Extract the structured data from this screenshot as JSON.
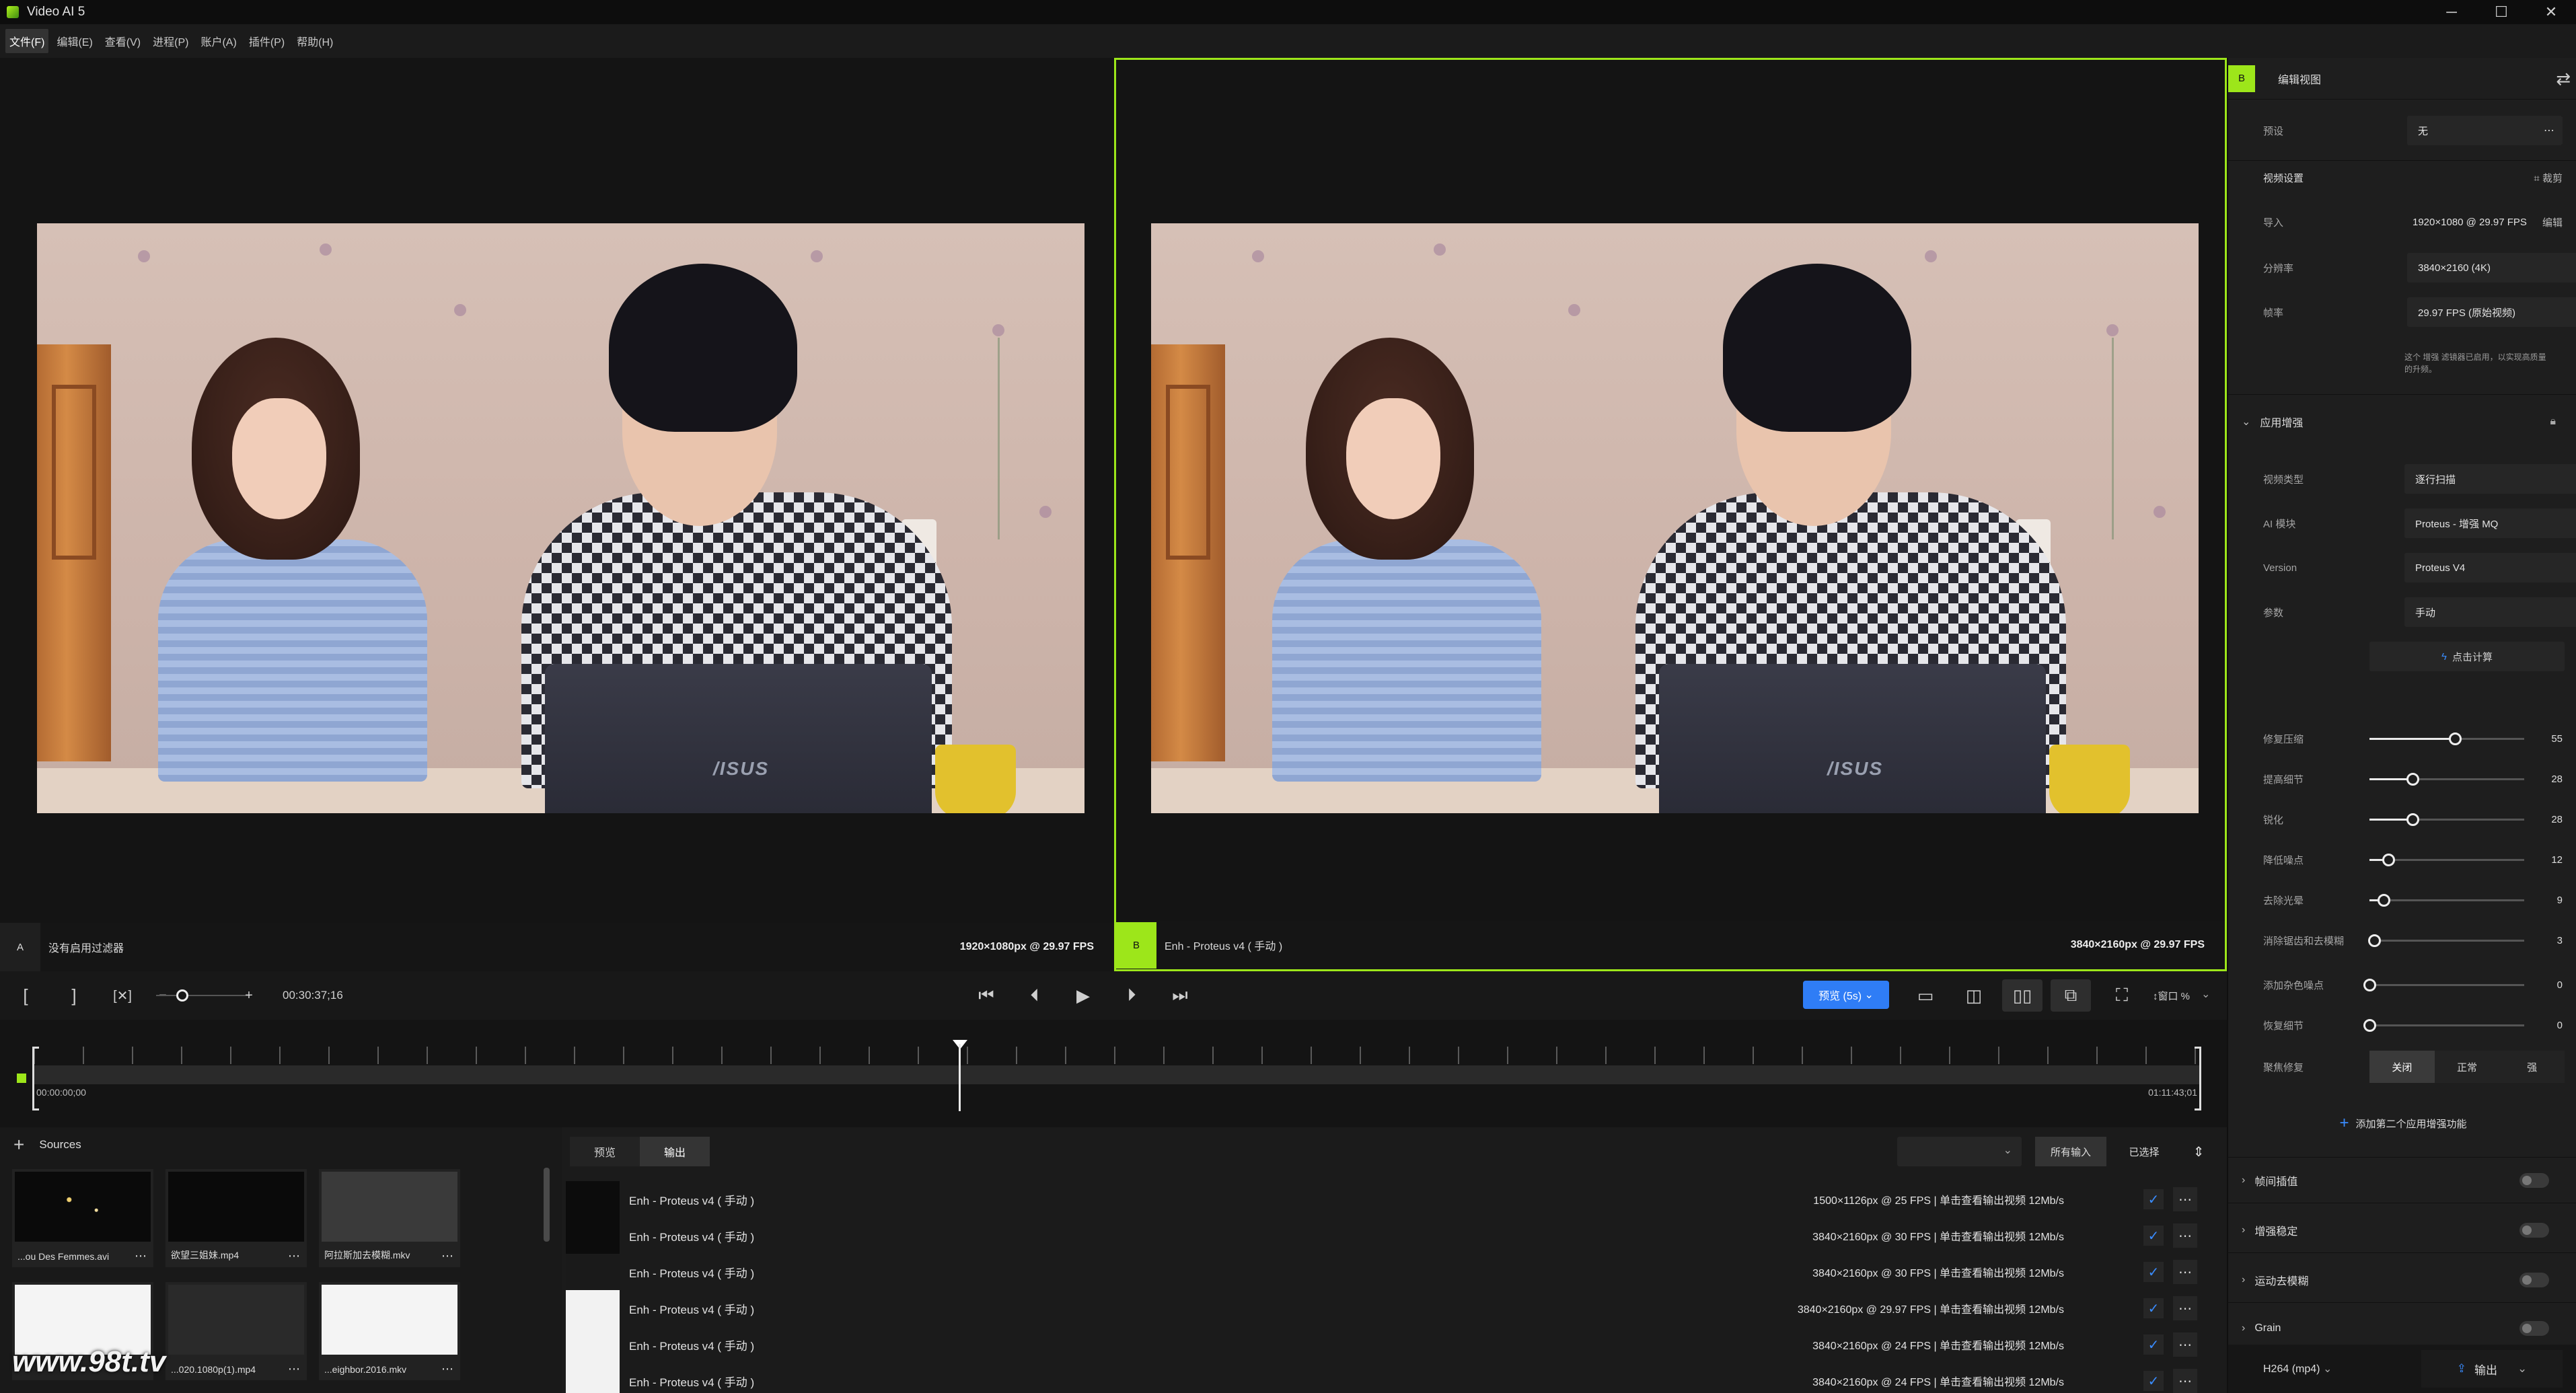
{
  "app": {
    "title": "Video AI 5"
  },
  "window_controls": {
    "minimize": "─",
    "maximize": "☐",
    "close": "✕"
  },
  "menu": [
    "文件(F)",
    "编辑(E)",
    "查看(V)",
    "进程(P)",
    "账户(A)",
    "插件(P)",
    "帮助(H)"
  ],
  "viewer_a": {
    "badge": "A",
    "label": "没有启用过滤器",
    "resolution": "1920×1080px @ 29.97 FPS"
  },
  "viewer_b": {
    "badge": "B",
    "label": "Enh - Proteus v4 ( 手动 )",
    "resolution": "3840×2160px @ 29.97 FPS"
  },
  "transport": {
    "timecode": "00:30:37;16",
    "preview_label": "预览 (5s)",
    "zoom_label": "↕窗口 %"
  },
  "timeline": {
    "start": "00:00:00;00",
    "end": "01:11:43;01"
  },
  "sources": {
    "title": "Sources",
    "items": [
      {
        "name": "...ou Des Femmes.avi"
      },
      {
        "name": "欲望三姐妹.mp4"
      },
      {
        "name": "阿拉斯加去模糊.mkv"
      },
      {
        "name": ""
      },
      {
        "name": "...020.1080p(1).mp4"
      },
      {
        "name": "...eighbor.2016.mkv"
      }
    ]
  },
  "exports": {
    "tabs": [
      "预览",
      "输出"
    ],
    "filters": [
      "所有输入",
      "已选择"
    ],
    "rows": [
      {
        "name": "Enh - Proteus v4 ( 手动 )",
        "spec": "1500×1126px @ 25 FPS  |  单击查看输出视频  12Mb/s"
      },
      {
        "name": "Enh - Proteus v4 ( 手动 )",
        "spec": "3840×2160px @ 30 FPS  |  单击查看输出视频  12Mb/s"
      },
      {
        "name": "Enh - Proteus v4 ( 手动 )",
        "spec": "3840×2160px @ 30 FPS  |  单击查看输出视频  12Mb/s"
      },
      {
        "name": "Enh - Proteus v4 ( 手动 )",
        "spec": "3840×2160px @ 29.97 FPS  |  单击查看输出视频  12Mb/s"
      },
      {
        "name": "Enh - Proteus v4 ( 手动 )",
        "spec": "3840×2160px @ 24 FPS  |  单击查看输出视频  12Mb/s"
      },
      {
        "name": "Enh - Proteus v4 ( 手动 )",
        "spec": "3840×2160px @ 24 FPS  |  单击查看输出视频  12Mb/s"
      }
    ]
  },
  "right_panel": {
    "badge": "B",
    "title": "编辑视图",
    "preset_label": "预设",
    "preset_value": "无",
    "video_settings": "视频设置",
    "crop_label": "裁剪",
    "input_label": "导入",
    "input_value": "1920×1080 @ 29.97 FPS",
    "input_edit": "编辑",
    "resolution_label": "分辨率",
    "resolution_value": "3840×2160 (4K)",
    "fps_label": "帧率",
    "fps_value": "29.97 FPS (原始视频)",
    "note": "这个 增强 滤镜器已启用，以实现高质量的升频。",
    "enhance_section": "应用增强",
    "video_type_label": "视频类型",
    "video_type_value": "逐行扫描",
    "ai_model_label": "AI 模块",
    "ai_model_value": "Proteus - 增强 MQ",
    "version_label": "Version",
    "version_value": "Proteus V4",
    "params_label": "参数",
    "params_value": "手动",
    "calc_button": "点击计算",
    "sliders": [
      {
        "label": "修复压缩",
        "value": 55
      },
      {
        "label": "提高细节",
        "value": 28
      },
      {
        "label": "锐化",
        "value": 28
      },
      {
        "label": "降低噪点",
        "value": 12
      },
      {
        "label": "去除光晕",
        "value": 9
      },
      {
        "label": "消除锯齿和去模糊",
        "value": 3
      },
      {
        "label": "添加杂色噪点",
        "value": 0
      },
      {
        "label": "恢复细节",
        "value": 0
      }
    ],
    "focus_fix_label": "聚焦修复",
    "focus_fix_options": [
      "关闭",
      "正常",
      "强"
    ],
    "add_second": "添加第二个应用增强功能",
    "sections": [
      "帧间插值",
      "增强稳定",
      "运动去模糊",
      "Grain"
    ],
    "format": "H264 (mp4)",
    "export_button": "输出"
  },
  "watermark": "www.98t.tv"
}
